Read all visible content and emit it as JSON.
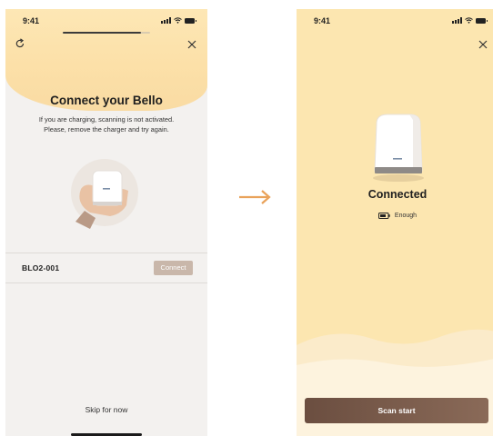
{
  "left_screen": {
    "status": {
      "time": "9:41"
    },
    "setup_progress": 0.9,
    "icons": {
      "refresh": "refresh-icon",
      "close": "close-icon"
    },
    "title": "Connect your Bello",
    "description_line1": "If you are charging, scanning is not activated.",
    "description_line2": "Please, remove the charger and try again.",
    "device": {
      "name": "BLO2-001",
      "connect_label": "Connect"
    },
    "skip_label": "Skip for now"
  },
  "transition_icon": "arrow-right-icon",
  "right_screen": {
    "status": {
      "time": "9:41"
    },
    "icons": {
      "close": "close-icon"
    },
    "status_title": "Connected",
    "battery_label": "Enough",
    "scan_button_label": "Scan start"
  },
  "colors": {
    "warm_yellow": "#fce6b0",
    "arrow_orange": "#e9a25a",
    "connect_button": "#c9b7aa",
    "scan_button": "#6b4e40"
  }
}
